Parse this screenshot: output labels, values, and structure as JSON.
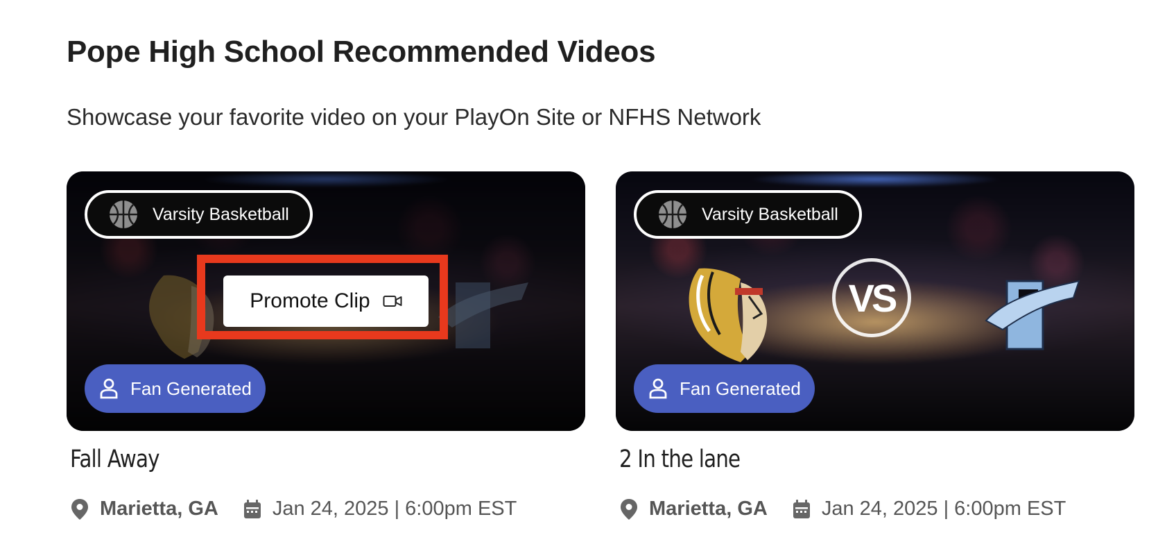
{
  "page": {
    "title": "Pope High School Recommended Videos",
    "subtitle": "Showcase your favorite video on your PlayOn Site or NFHS Network"
  },
  "cards": [
    {
      "sport": "Varsity Basketball",
      "badge": "Fan Generated",
      "title": "Fall Away",
      "location": "Marietta, GA",
      "datetime": "Jan 24, 2025 | 6:00pm EST",
      "promote_label": "Promote Clip"
    },
    {
      "sport": "Varsity Basketball",
      "badge": "Fan Generated",
      "vs_text": "VS",
      "title": "2 In the lane",
      "location": "Marietta, GA",
      "datetime": "Jan 24, 2025 | 6:00pm EST"
    }
  ],
  "colors": {
    "fan_badge": "#4a5fc1",
    "highlight_box": "#e8391d"
  },
  "icons": [
    "basketball-icon",
    "person-icon",
    "video-camera-icon",
    "map-pin-icon",
    "calendar-icon"
  ]
}
